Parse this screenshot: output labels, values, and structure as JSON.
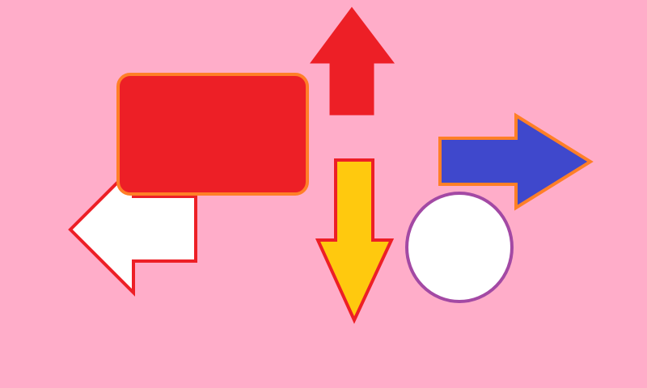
{
  "scene": {
    "background_color": "#FFADC9",
    "shapes": [
      {
        "id": "rounded-rectangle",
        "kind": "rounded-rectangle",
        "fill": "#ED1F26",
        "stroke": "#FF7F27"
      },
      {
        "id": "arrow-up",
        "kind": "arrow",
        "direction": "up",
        "fill": "#ED1F26",
        "stroke": "#ED1F26"
      },
      {
        "id": "arrow-right",
        "kind": "arrow",
        "direction": "right",
        "fill": "#3F48CC",
        "stroke": "#FF7F27"
      },
      {
        "id": "arrow-left",
        "kind": "arrow",
        "direction": "left",
        "fill": "#FFFFFF",
        "stroke": "#ED1F26"
      },
      {
        "id": "arrow-down",
        "kind": "arrow",
        "direction": "down",
        "fill": "#FFC90E",
        "stroke": "#ED1F26"
      },
      {
        "id": "circle",
        "kind": "circle",
        "fill": "#FFFFFF",
        "stroke": "#A349A4"
      }
    ]
  }
}
